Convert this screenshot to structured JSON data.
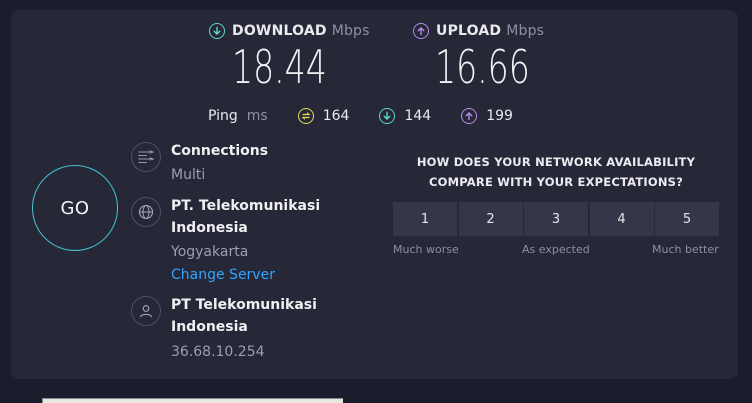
{
  "download": {
    "label": "DOWNLOAD",
    "unit": "Mbps",
    "value": "18.44"
  },
  "upload": {
    "label": "UPLOAD",
    "unit": "Mbps",
    "value": "16.66"
  },
  "ping": {
    "label": "Ping",
    "unit": "ms",
    "idle": "164",
    "download": "144",
    "upload": "199"
  },
  "go_label": "GO",
  "connections": {
    "title": "Connections",
    "value": "Multi"
  },
  "server": {
    "name_line1": "PT. Telekomunikasi",
    "name_line2": "Indonesia",
    "location": "Yogyakarta",
    "change_label": "Change Server"
  },
  "provider": {
    "name_line1": "PT Telekomunikasi",
    "name_line2": "Indonesia",
    "ip": "36.68.10.254"
  },
  "survey": {
    "question_line1": "HOW DOES YOUR NETWORK AVAILABILITY",
    "question_line2": "COMPARE WITH YOUR EXPECTATIONS?",
    "options": [
      "1",
      "2",
      "3",
      "4",
      "5"
    ],
    "low_label": "Much worse",
    "mid_label": "As expected",
    "high_label": "Much better"
  },
  "colors": {
    "download_accent": "#5fd6ce",
    "upload_accent": "#b98bf0",
    "ping_idle_accent": "#e8d95d",
    "go_ring": "#44c6d4",
    "link": "#2fa4ff"
  },
  "icons": {
    "download": "arrow-down-circle-icon",
    "upload": "arrow-up-circle-icon",
    "ping_idle": "lightning-circle-icon",
    "connections": "connections-icon",
    "server": "globe-icon",
    "provider": "user-icon"
  }
}
